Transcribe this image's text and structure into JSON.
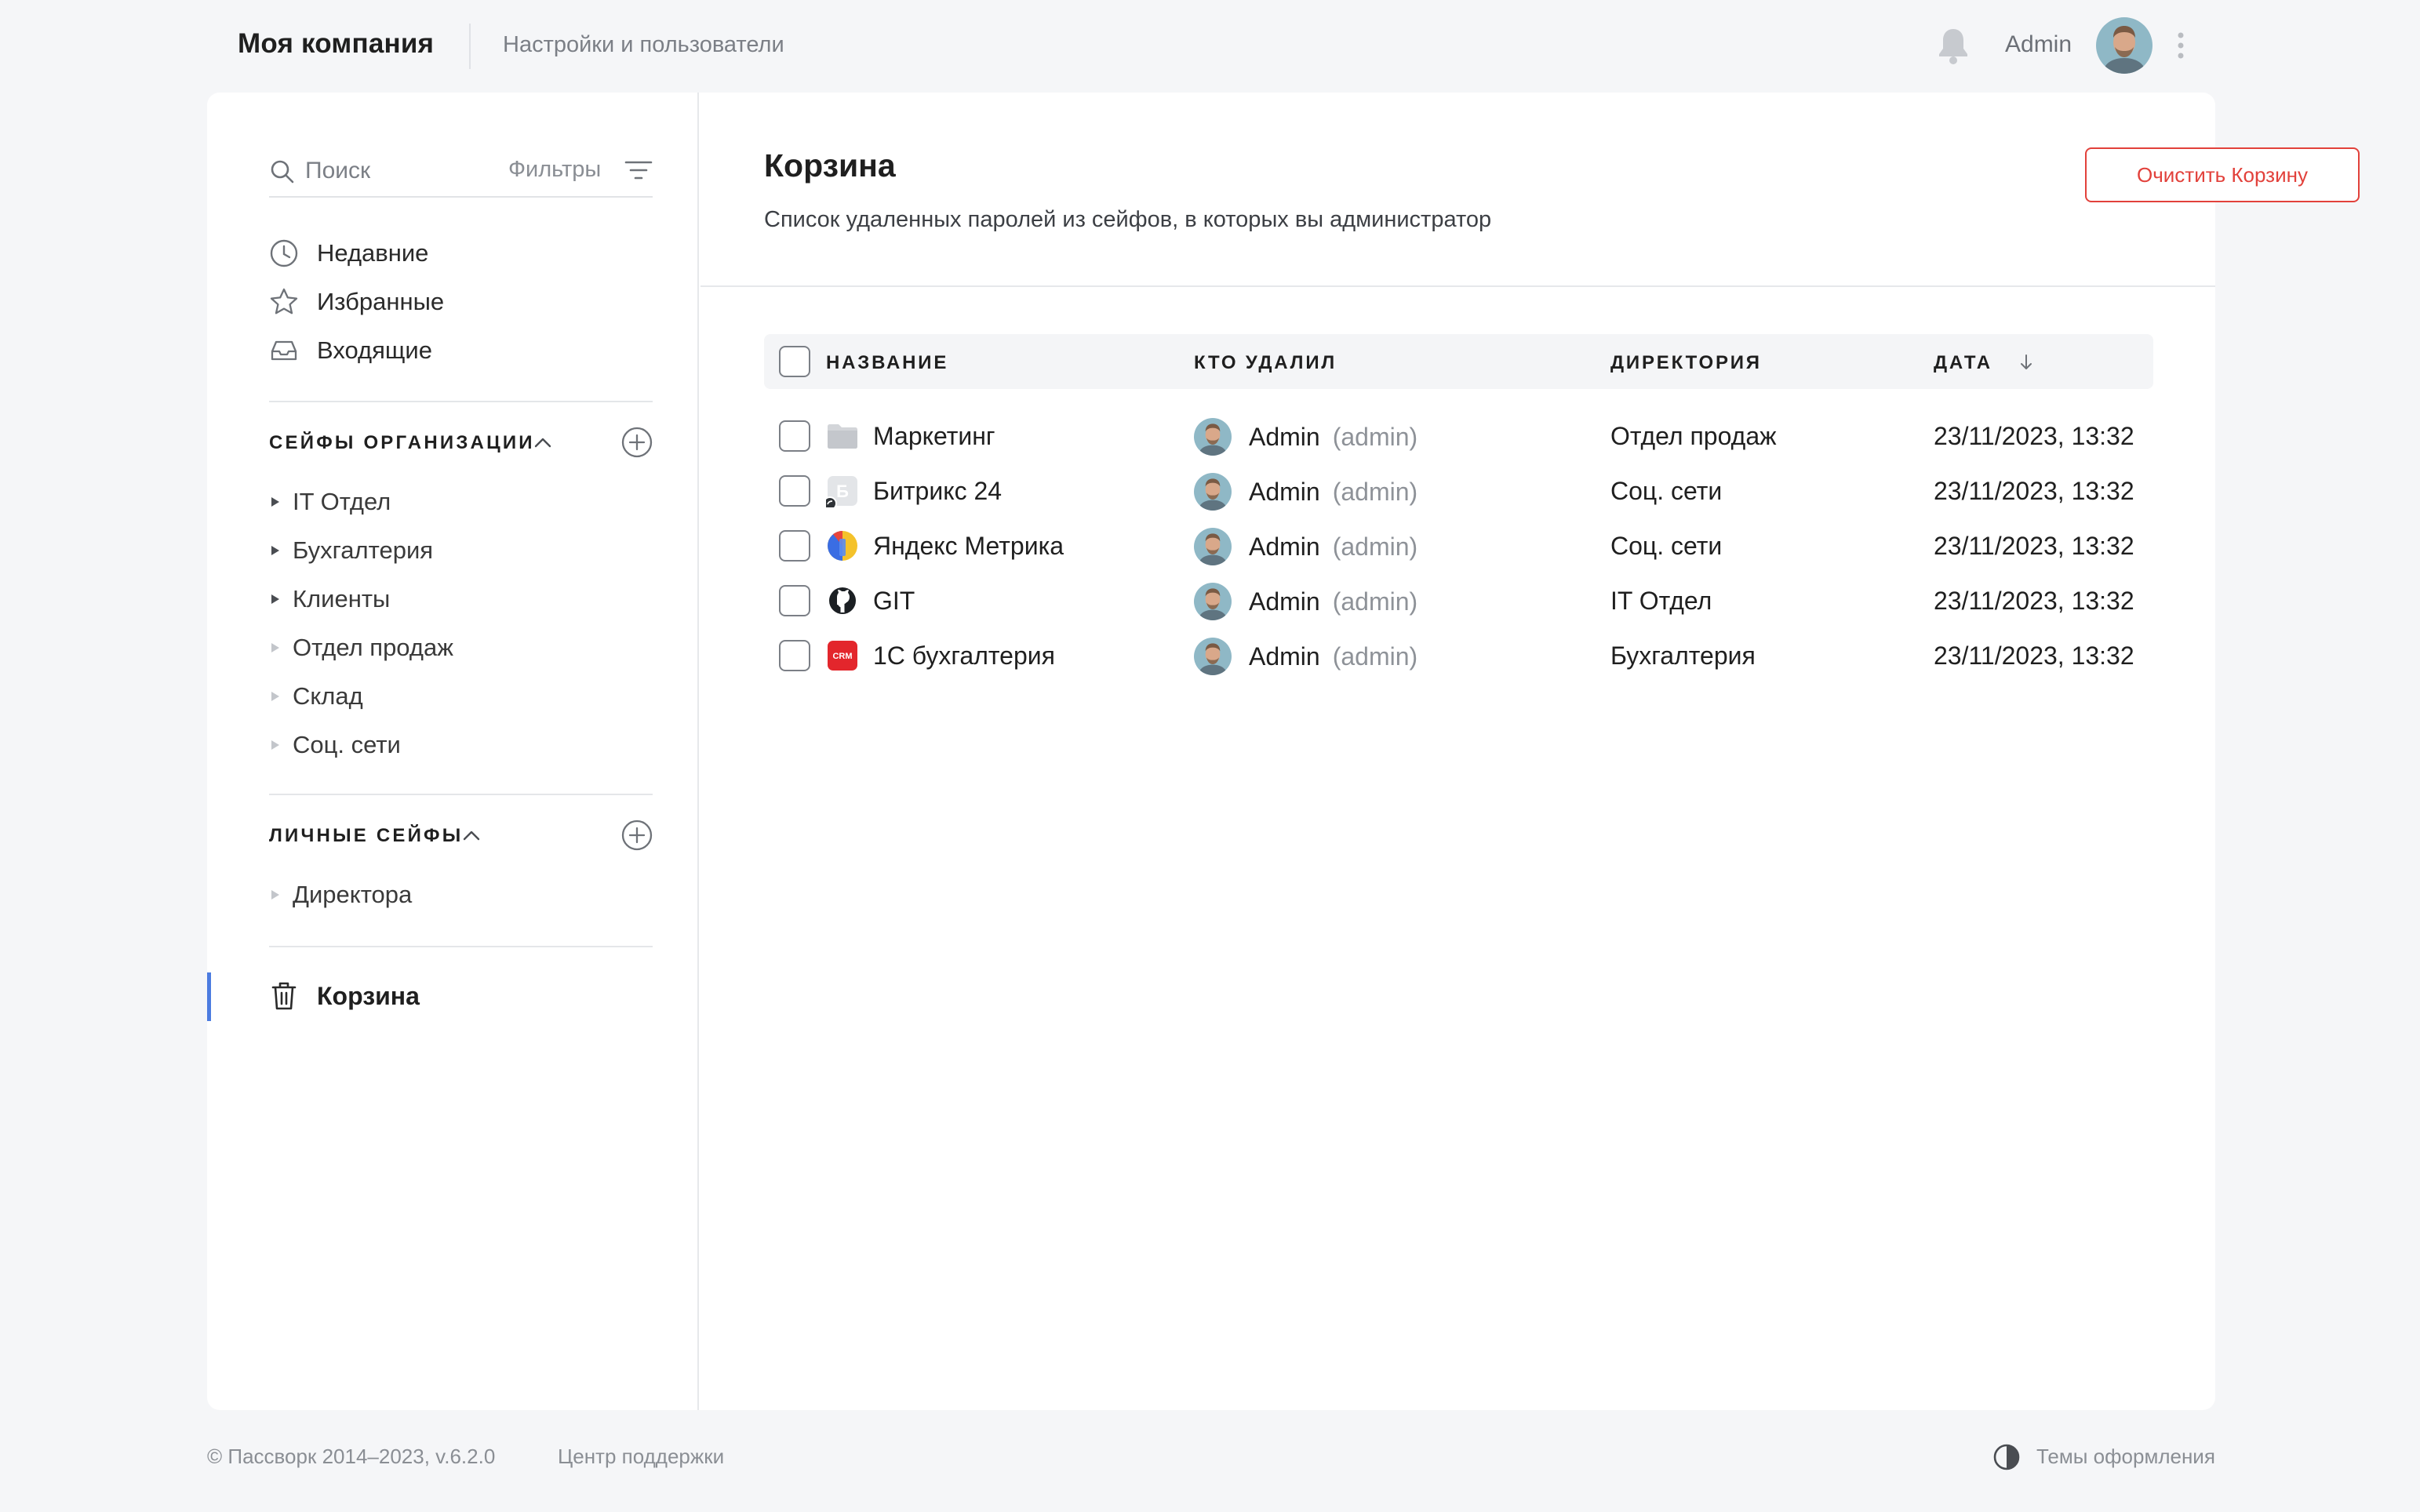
{
  "header": {
    "brand": "Моя компания",
    "section": "Настройки и пользователи",
    "user_name": "Admin"
  },
  "search": {
    "placeholder": "Поиск",
    "filters_label": "Фильтры"
  },
  "nav": {
    "recent": "Недавние",
    "favorites": "Избранные",
    "inbox": "Входящие"
  },
  "org_vaults": {
    "title": "СЕЙФЫ ОРГАНИЗАЦИИ",
    "items": [
      "IT Отдел",
      "Бухгалтерия",
      "Клиенты",
      "Отдел продаж",
      "Склад",
      "Соц. сети"
    ]
  },
  "personal_vaults": {
    "title": "ЛИЧНЫЕ СЕЙФЫ",
    "items": [
      "Директора"
    ]
  },
  "trash_nav": {
    "label": "Корзина"
  },
  "page": {
    "title": "Корзина",
    "subtitle": "Список удаленных паролей из сейфов, в которых вы администратор",
    "clear_button": "Очистить Корзину"
  },
  "table": {
    "columns": {
      "name": "НАЗВАНИЕ",
      "deleted_by": "КТО УДАЛИЛ",
      "directory": "ДИРЕКТОРИЯ",
      "date": "ДАТА"
    },
    "rows": [
      {
        "name": "Маркетинг",
        "icon": "folder-icon",
        "user": "Admin",
        "login": "(admin)",
        "directory": "Отдел продаж",
        "date": "23/11/2023, 13:32"
      },
      {
        "name": "Битрикс 24",
        "icon": "bitrix-icon",
        "user": "Admin",
        "login": "(admin)",
        "directory": "Соц. сети",
        "date": "23/11/2023, 13:32"
      },
      {
        "name": "Яндекс Метрика",
        "icon": "yandex-metrika-icon",
        "user": "Admin",
        "login": "(admin)",
        "directory": "Соц. сети",
        "date": "23/11/2023, 13:32"
      },
      {
        "name": "GIT",
        "icon": "github-icon",
        "user": "Admin",
        "login": "(admin)",
        "directory": "IT Отдел",
        "date": "23/11/2023, 13:32"
      },
      {
        "name": "1С бухгалтерия",
        "icon": "crm-icon",
        "user": "Admin",
        "login": "(admin)",
        "directory": "Бухгалтерия",
        "date": "23/11/2023, 13:32"
      }
    ]
  },
  "footer": {
    "copyright": "© Пассворк 2014–2023, v.6.2.0",
    "support": "Центр поддержки",
    "themes": "Темы оформления"
  },
  "colors": {
    "accent": "#4c7ce0",
    "danger": "#e2413b",
    "background": "#f5f6f8"
  }
}
